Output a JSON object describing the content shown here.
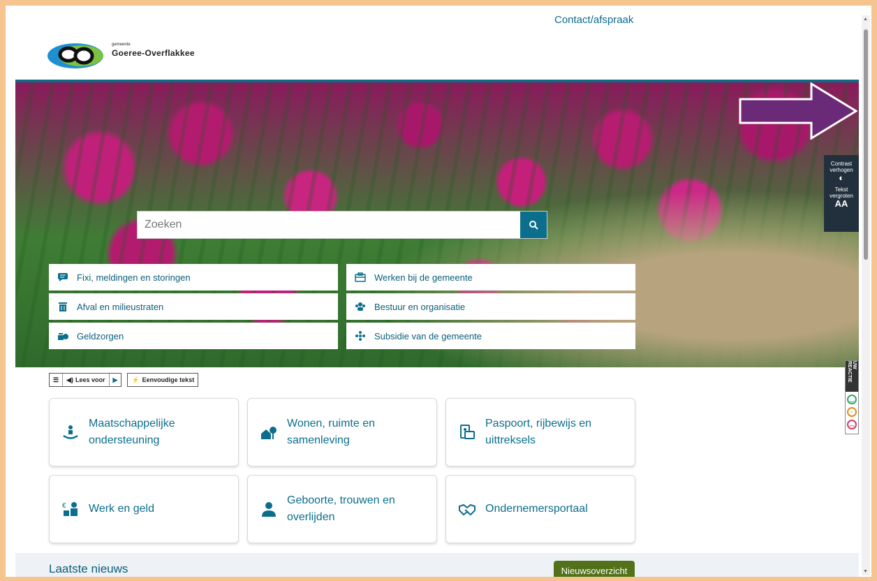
{
  "header": {
    "contact_link": "Contact/afspraak",
    "logo_small": "gemeente",
    "logo_name": "Goeree-Overflakkee"
  },
  "search": {
    "placeholder": "Zoeken"
  },
  "quick_links": [
    {
      "label": "Fixi, meldingen en storingen",
      "icon": "chat-bubble-icon"
    },
    {
      "label": "Werken bij de gemeente",
      "icon": "briefcase-icon"
    },
    {
      "label": "Afval en milieustraten",
      "icon": "trash-icon"
    },
    {
      "label": "Bestuur en organisatie",
      "icon": "people-icon"
    },
    {
      "label": "Geldzorgen",
      "icon": "money-icon"
    },
    {
      "label": "Subsidie van de gemeente",
      "icon": "group-icon"
    }
  ],
  "side_tools": {
    "contrast_line1": "Contrast",
    "contrast_line2": "verhogen",
    "text_line1": "Tekst",
    "text_line2": "vergroten",
    "text_symbol": "AA"
  },
  "readbar": {
    "read_label": "Lees voor",
    "simple_label": "Eenvoudige tekst"
  },
  "cards": [
    {
      "label": "Maatschappelijke ondersteuning",
      "icon": "helping-hands-icon"
    },
    {
      "label": "Wonen, ruimte en samenleving",
      "icon": "houses-icon"
    },
    {
      "label": "Paspoort, rijbewijs en uittreksels",
      "icon": "id-document-icon"
    },
    {
      "label": "Werk en geld",
      "icon": "worker-money-icon"
    },
    {
      "label": "Geboorte, trouwen en overlijden",
      "icon": "person-icon"
    },
    {
      "label": "Ondernemersportaal",
      "icon": "handshake-icon"
    }
  ],
  "feedback": {
    "label": "UW REACTIE"
  },
  "news": {
    "title": "Laatste nieuws",
    "button": "Nieuwsoverzicht"
  },
  "colors": {
    "accent": "#0b6e8c",
    "news_button": "#52711a",
    "frame": "#f5c48f",
    "arrow": "#6b2a78"
  }
}
